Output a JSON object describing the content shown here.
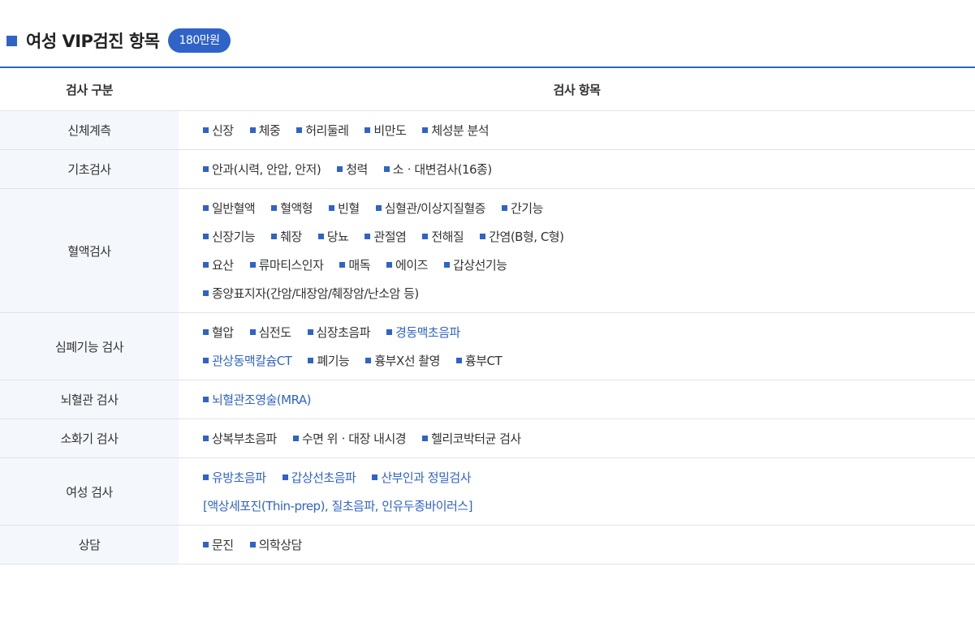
{
  "header": {
    "title": "여성 VIP검진 항목",
    "price": "180만원"
  },
  "table": {
    "headers": {
      "category": "검사 구분",
      "items": "검사 항목"
    },
    "rows": [
      {
        "category": "신체계측",
        "lines": [
          [
            {
              "text": "신장"
            },
            {
              "text": "체중"
            },
            {
              "text": "허리둘레"
            },
            {
              "text": "비만도"
            },
            {
              "text": "체성분 분석"
            }
          ]
        ]
      },
      {
        "category": "기초검사",
        "lines": [
          [
            {
              "text": "안과(시력, 안압, 안저)"
            },
            {
              "text": "청력"
            },
            {
              "text": "소ㆍ대변검사(16종)"
            }
          ]
        ]
      },
      {
        "category": "혈액검사",
        "lines": [
          [
            {
              "text": "일반혈액"
            },
            {
              "text": "혈액형"
            },
            {
              "text": "빈혈"
            },
            {
              "text": "심혈관/이상지질혈증"
            },
            {
              "text": "간기능"
            }
          ],
          [
            {
              "text": "신장기능"
            },
            {
              "text": "췌장"
            },
            {
              "text": "당뇨"
            },
            {
              "text": "관절염"
            },
            {
              "text": "전해질"
            },
            {
              "text": "간염(B형, C형)"
            }
          ],
          [
            {
              "text": "요산"
            },
            {
              "text": "류마티스인자"
            },
            {
              "text": "매독"
            },
            {
              "text": "에이즈"
            },
            {
              "text": "갑상선기능"
            }
          ],
          [
            {
              "text": "종양표지자(간암/대장암/췌장암/난소암 등)"
            }
          ]
        ]
      },
      {
        "category": "심폐기능 검사",
        "lines": [
          [
            {
              "text": "혈압"
            },
            {
              "text": "심전도"
            },
            {
              "text": "심장초음파"
            },
            {
              "text": "경동맥초음파",
              "highlight": true
            }
          ],
          [
            {
              "text": "관상동맥칼슘CT",
              "highlight": true
            },
            {
              "text": "폐기능"
            },
            {
              "text": "흉부X선 촬영"
            },
            {
              "text": "흉부CT"
            }
          ]
        ]
      },
      {
        "category": "뇌혈관 검사",
        "lines": [
          [
            {
              "text": "뇌혈관조영술(MRA)",
              "highlight": true
            }
          ]
        ]
      },
      {
        "category": "소화기 검사",
        "lines": [
          [
            {
              "text": "상복부초음파"
            },
            {
              "text": "수면 위ㆍ대장 내시경"
            },
            {
              "text": "헬리코박터균 검사"
            }
          ]
        ]
      },
      {
        "category": "여성 검사",
        "lines": [
          [
            {
              "text": "유방초음파",
              "highlight": true
            },
            {
              "text": "갑상선초음파",
              "highlight": true
            },
            {
              "text": "산부인과 정밀검사",
              "highlight": true
            }
          ]
        ],
        "note": "[액상세포진(Thin-prep), 질초음파, 인유두종바이러스]"
      },
      {
        "category": "상담",
        "lines": [
          [
            {
              "text": "문진"
            },
            {
              "text": "의학상담"
            }
          ]
        ]
      }
    ]
  }
}
